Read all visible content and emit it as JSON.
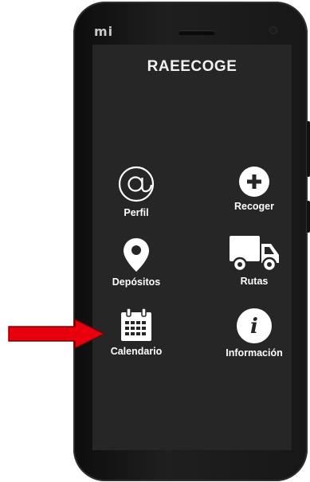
{
  "device": {
    "brand_logo": "mi"
  },
  "app": {
    "title": "RAEECOGE"
  },
  "menu": {
    "perfil": {
      "label": "Perfil",
      "icon": "at-sign-icon"
    },
    "recoger": {
      "label": "Recoger",
      "icon": "plus-circle-icon"
    },
    "depositos": {
      "label": "Depósitos",
      "icon": "location-pin-icon"
    },
    "rutas": {
      "label": "Rutas",
      "icon": "truck-icon"
    },
    "calendario": {
      "label": "Calendario",
      "icon": "calendar-icon"
    },
    "informacion": {
      "label": "Información",
      "icon": "info-icon"
    }
  },
  "colors": {
    "screen_bg": "#262626",
    "icon": "#ffffff",
    "arrow": "#e8000d"
  }
}
